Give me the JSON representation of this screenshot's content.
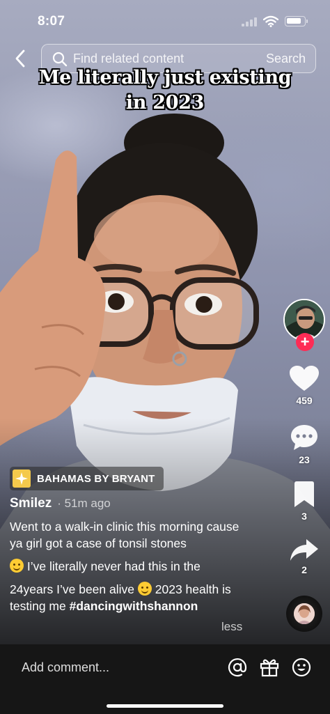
{
  "status_bar": {
    "time": "8:07",
    "battery_level": 0.85
  },
  "search": {
    "placeholder": "Find related content",
    "button_label": "Search"
  },
  "video": {
    "overlay_caption_lines": [
      "Me literally just existing",
      "in 2023"
    ]
  },
  "actions": {
    "likes": "459",
    "comments": "23",
    "saves": "3",
    "shares": "2"
  },
  "sound": {
    "label": "BAHAMAS BY BRYANT"
  },
  "post": {
    "author": "Smilez",
    "time": "· 51m ago",
    "caption_line1": "Went to a walk-in clinic this morning cause ya girl got a case of tonsil stones",
    "caption_line2": "I’ve literally never had this in the",
    "caption_line3a": "24years I’ve been alive",
    "caption_line3b": "2023 health is testing me",
    "hashtag": "#dancingwithshannon",
    "less_label": "less"
  },
  "comment_bar": {
    "placeholder": "Add comment..."
  },
  "icons": {
    "back": "chevron-left-icon",
    "search": "search-icon",
    "like": "heart-icon",
    "comment": "comment-bubble-icon",
    "save": "bookmark-icon",
    "share": "share-arrow-icon",
    "mention": "at-sign-icon",
    "gift": "gift-icon",
    "emoji": "smiley-icon"
  },
  "colors": {
    "follow_accent": "#fe2c55",
    "comment_bar_bg": "#161616"
  }
}
